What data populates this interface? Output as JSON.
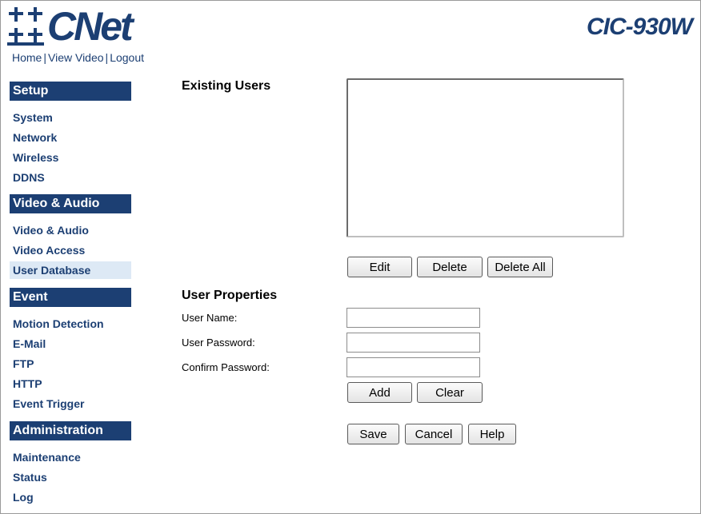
{
  "brand": {
    "logo_text": "CNet",
    "model": "CIC-930W"
  },
  "toplinks": {
    "home": "Home",
    "view_video": "View Video",
    "logout": "Logout",
    "separator": "|"
  },
  "sidebar": {
    "sections": [
      {
        "title": "Setup",
        "items": [
          "System",
          "Network",
          "Wireless",
          "DDNS"
        ]
      },
      {
        "title": "Video & Audio",
        "items": [
          "Video & Audio",
          "Video Access",
          "User Database"
        ]
      },
      {
        "title": "Event",
        "items": [
          "Motion Detection",
          "E-Mail",
          "FTP",
          "HTTP",
          "Event Trigger"
        ]
      },
      {
        "title": "Administration",
        "items": [
          "Maintenance",
          "Status",
          "Log"
        ]
      }
    ],
    "active_item": "User Database"
  },
  "main": {
    "existing_users_label": "Existing Users",
    "existing_users": [],
    "buttons": {
      "edit": "Edit",
      "delete": "Delete",
      "delete_all": "Delete All",
      "add": "Add",
      "clear": "Clear",
      "save": "Save",
      "cancel": "Cancel",
      "help": "Help"
    },
    "user_properties_label": "User Properties",
    "fields": {
      "user_name_label": "User Name:",
      "user_name_value": "",
      "user_password_label": "User Password:",
      "user_password_value": "",
      "confirm_password_label": "Confirm Password:",
      "confirm_password_value": ""
    }
  },
  "colors": {
    "brand_blue": "#1c3f73",
    "active_bg": "#dde9f5"
  }
}
